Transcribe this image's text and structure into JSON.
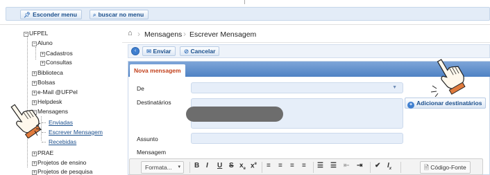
{
  "topbar": {
    "hide_menu_label": "Esconder menu",
    "search_menu_label": "buscar no menu"
  },
  "tree": {
    "root": "UFPEL",
    "aluno": "Aluno",
    "cadastros": "Cadastros",
    "consultas": "Consultas",
    "biblioteca": "Biblioteca",
    "bolsas": "Bolsas",
    "email": "e-Mail @UFPel",
    "helpdesk": "Helpdesk",
    "mensagens": "Mensagens",
    "enviadas": "Enviadas",
    "escrever": "Escrever Mensagem",
    "recebidas": "Recebidas",
    "prae": "PRAE",
    "proj_ensino": "Projetos de ensino",
    "proj_pesquisa": "Projetos de pesquisa"
  },
  "breadcrumb": {
    "home_icon": "home-icon",
    "crumb1": "Mensagens",
    "crumb2": "Escrever Mensagem"
  },
  "actions": {
    "send_label": "Enviar",
    "cancel_label": "Cancelar"
  },
  "form": {
    "tab_label": "Nova mensagem",
    "from_label": "De",
    "recipients_label": "Destinatários",
    "add_recipients_label": "Adicionar destinatários",
    "subject_label": "Assunto",
    "message_label": "Mensagem"
  },
  "editor": {
    "format_label": "Formata...",
    "source_label": "Código-Fonte"
  },
  "colors": {
    "accent": "#1b4f8c",
    "tab_text": "#c2401b",
    "panel_header": "#4f82c4"
  }
}
